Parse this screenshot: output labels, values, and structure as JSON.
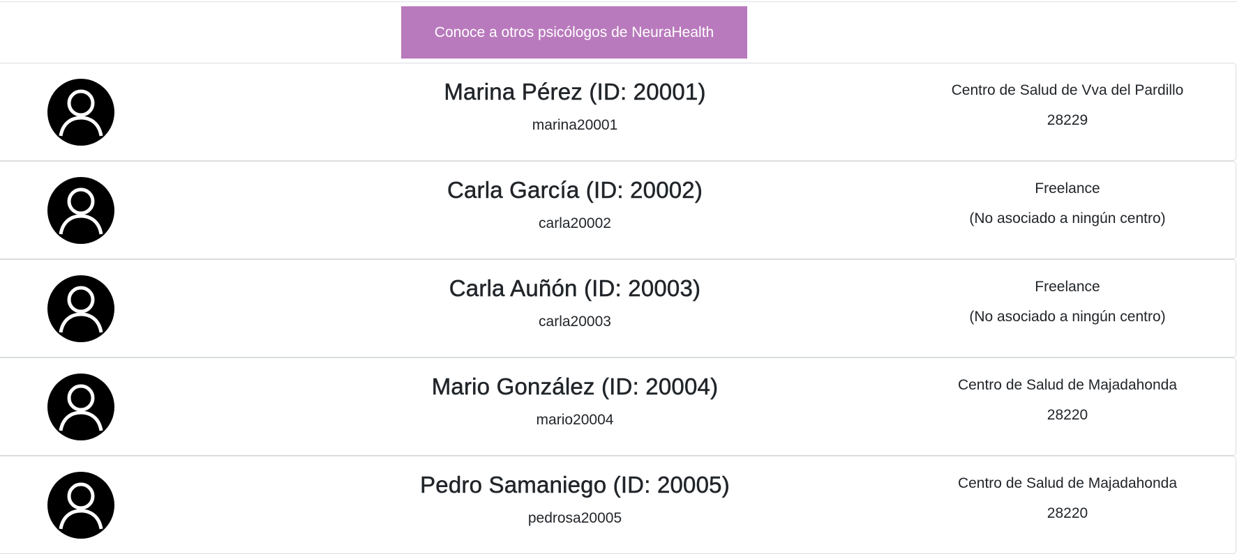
{
  "header": {
    "cta_label": "Conoce a otros psicólogos de NeuraHealth",
    "accent_color": "#b97abd"
  },
  "psychologists": [
    {
      "name": "Marina Pérez (ID: 20001)",
      "username": "marina20001",
      "center": "Centro de Salud de Vva del Pardillo",
      "detail": "28229",
      "avatar_icon": "user-avatar-icon"
    },
    {
      "name": "Carla García (ID: 20002)",
      "username": "carla20002",
      "center": "Freelance",
      "detail": "(No asociado a ningún centro)",
      "avatar_icon": "user-avatar-icon"
    },
    {
      "name": "Carla Auñón (ID: 20003)",
      "username": "carla20003",
      "center": "Freelance",
      "detail": "(No asociado a ningún centro)",
      "avatar_icon": "user-avatar-icon"
    },
    {
      "name": "Mario González (ID: 20004)",
      "username": "mario20004",
      "center": "Centro de Salud de Majadahonda",
      "detail": "28220",
      "avatar_icon": "user-avatar-icon"
    },
    {
      "name": "Pedro Samaniego (ID: 20005)",
      "username": "pedrosa20005",
      "center": "Centro de Salud de Majadahonda",
      "detail": "28220",
      "avatar_icon": "user-avatar-icon"
    }
  ]
}
